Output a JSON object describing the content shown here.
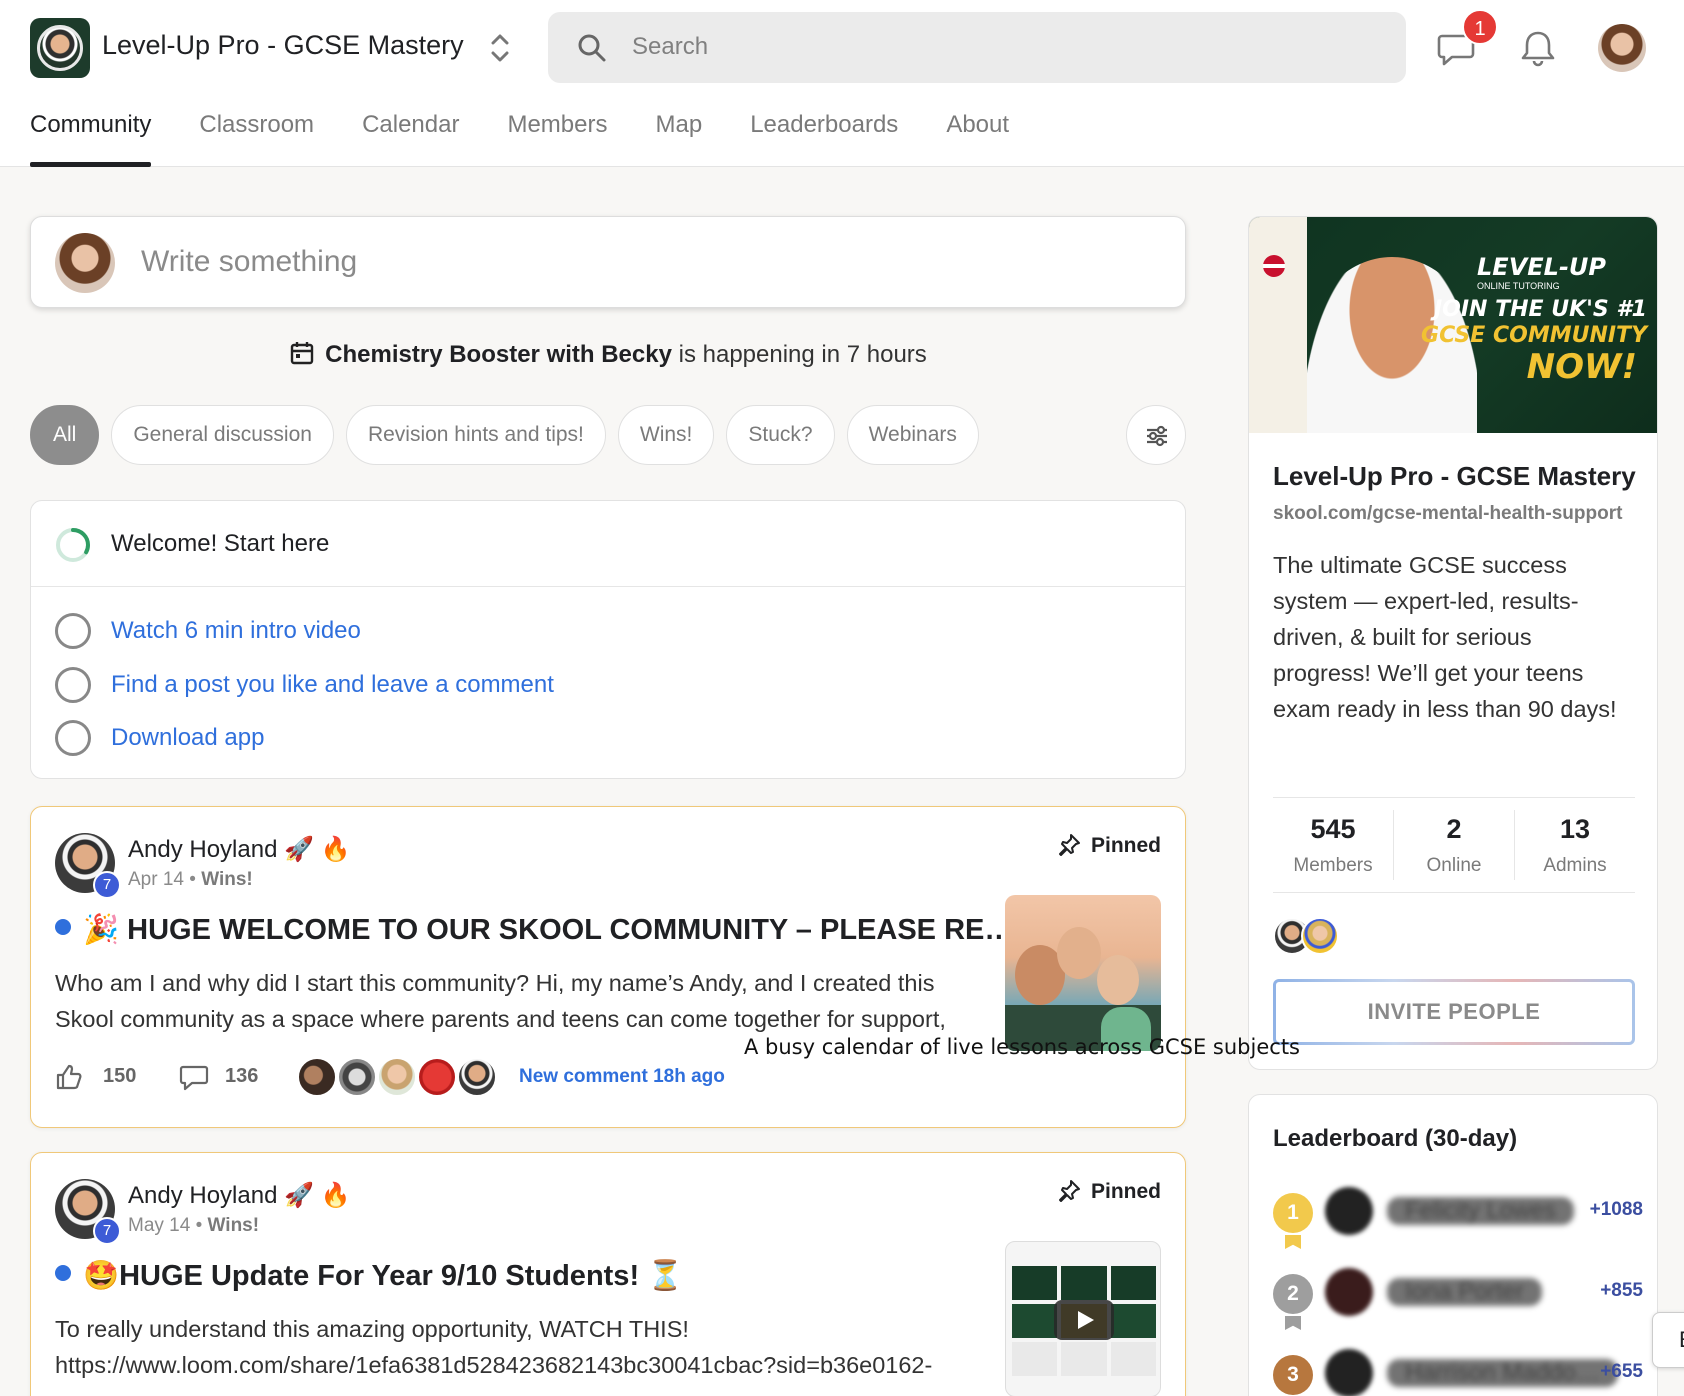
{
  "app": {
    "title": "Level-Up Pro - GCSE Mastery",
    "logo_icon": "community-logo-icon"
  },
  "search": {
    "placeholder": "Search",
    "value": ""
  },
  "header": {
    "chat_badge": "1"
  },
  "nav": {
    "tabs": [
      {
        "label": "Community",
        "active": true
      },
      {
        "label": "Classroom"
      },
      {
        "label": "Calendar"
      },
      {
        "label": "Members"
      },
      {
        "label": "Map"
      },
      {
        "label": "Leaderboards"
      },
      {
        "label": "About"
      }
    ]
  },
  "composer": {
    "placeholder": "Write something"
  },
  "event": {
    "name": "Chemistry Booster with Becky",
    "suffix": " is happening in 7 hours"
  },
  "categories": [
    "All",
    "General discussion",
    "Revision hints and tips!",
    "Wins!",
    "Stuck?",
    "Webinars"
  ],
  "welcome": {
    "title": "Welcome! Start here",
    "progress": 0.33,
    "items": [
      "Watch 6 min intro video",
      "Find a post you like and leave a comment",
      "Download app"
    ]
  },
  "posts": [
    {
      "author": "Andy Hoyland",
      "author_emoji": "🚀 🔥",
      "level": "7",
      "date": "Apr 14",
      "category": "Wins!",
      "pinned": "Pinned",
      "title": "🎉 HUGE WELCOME TO OUR SKOOL COMMUNITY – PLEASE READ…",
      "body": "Who am I and why did I start this community? Hi, my name’s Andy, and I created this Skool community as a space where parents and teens can come together for support,",
      "likes": "150",
      "comments": "136",
      "new_comment": "New comment 18h ago"
    },
    {
      "author": "Andy Hoyland",
      "author_emoji": "🚀 🔥",
      "level": "7",
      "date": "May 14",
      "category": "Wins!",
      "pinned": "Pinned",
      "title": "🤩HUGE Update For Year 9/10 Students! ⏳",
      "body": "To really understand this amazing opportunity, WATCH THIS! https://www.loom.com/share/1efa6381d528423682143bc30041cbac?sid=b36e0162-"
    }
  ],
  "caption": "A busy calendar of live lessons across GCSE subjects",
  "about": {
    "banner": {
      "brand": "LEVEL-UP",
      "brand_sub": "ONLINE TUTORING",
      "line1": "JOIN THE UK'S #1",
      "line2": "GCSE COMMUNITY",
      "line3": "NOW!"
    },
    "name": "Level-Up Pro - GCSE Mastery",
    "url": "skool.com/gcse-mental-health-support",
    "description": "The ultimate GCSE success system — expert-led, results-driven, & built for serious progress! We’ll get your teens exam ready in less than 90 days!",
    "stats": [
      {
        "num": "545",
        "label": "Members"
      },
      {
        "num": "2",
        "label": "Online"
      },
      {
        "num": "13",
        "label": "Admins"
      }
    ],
    "invite": "INVITE PEOPLE"
  },
  "leaderboard": {
    "title": "Leaderboard (30-day)",
    "rows": [
      {
        "rank": "1",
        "name": "Felicity Lowes",
        "points": "+1088",
        "color": "#f2c94c"
      },
      {
        "rank": "2",
        "name": "Iona Porter",
        "points": "+855",
        "color": "#9e9e9e"
      },
      {
        "rank": "3",
        "name": "Harrison Maddo…",
        "points": "+655",
        "color": "#b7773e"
      }
    ]
  },
  "edge_tab": "E",
  "colors": {
    "accent_blue": "#2f6fdc",
    "badge_red": "#e53935",
    "pinned_border": "#f0c879",
    "level_blue": "#3d5bd6"
  }
}
